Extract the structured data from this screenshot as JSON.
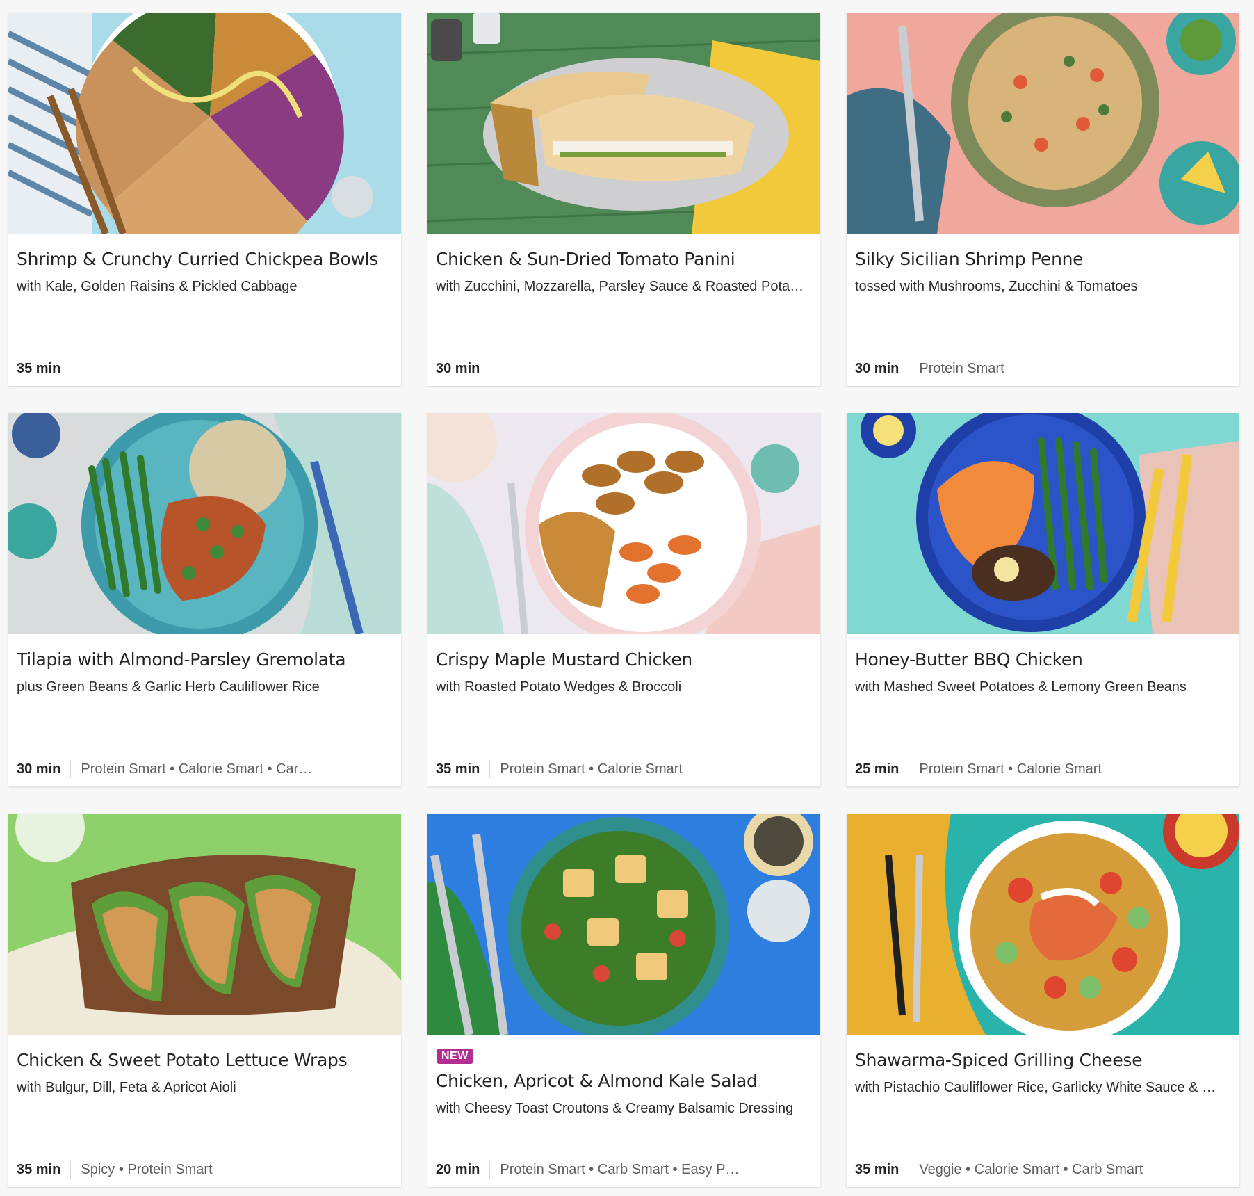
{
  "recipes": [
    {
      "title": "Shrimp & Crunchy Curried Chickpea Bowls",
      "subtitle": "with Kale, Golden Raisins & Pickled Cabbage",
      "time": "35 min",
      "tags": "",
      "badge": "",
      "image": "bowl-with-chickpeas-kale-cabbage",
      "bg_color": "#a9dbe8",
      "accent": "#d9b34a"
    },
    {
      "title": "Chicken & Sun-Dried Tomato Panini",
      "subtitle": "with Zucchini, Mozzarella, Parsley Sauce & Roasted Pota…",
      "time": "30 min",
      "tags": "",
      "badge": "",
      "image": "panini-on-plate",
      "bg_color": "#4f8a57",
      "accent": "#e9c98f"
    },
    {
      "title": "Silky Sicilian Shrimp Penne",
      "subtitle": "tossed with Mushrooms, Zucchini & Tomatoes",
      "time": "30 min",
      "tags": "Protein Smart",
      "badge": "",
      "image": "penne-bowl",
      "bg_color": "#f0a79c",
      "accent": "#d9b47c"
    },
    {
      "title": "Tilapia with Almond-Parsley Gremolata",
      "subtitle": "plus Green Beans & Garlic Herb Cauliflower Rice",
      "time": "30 min",
      "tags": "Protein Smart • Calorie Smart • Car…",
      "badge": "",
      "image": "tilapia-plate",
      "bg_color": "#d9dcdc",
      "accent": "#c0652c"
    },
    {
      "title": "Crispy Maple Mustard Chicken",
      "subtitle": "with Roasted Potato Wedges & Broccoli",
      "time": "35 min",
      "tags": "Protein Smart • Calorie Smart",
      "badge": "",
      "image": "chicken-potato-plate",
      "bg_color": "#f3c9c3",
      "accent": "#e2722e"
    },
    {
      "title": "Honey-Butter BBQ Chicken",
      "subtitle": "with Mashed Sweet Potatoes & Lemony Green Beans",
      "time": "25 min",
      "tags": "Protein Smart • Calorie Smart",
      "badge": "",
      "image": "bbq-chicken-plate",
      "bg_color": "#7fd8d2",
      "accent": "#f28a3c"
    },
    {
      "title": "Chicken & Sweet Potato Lettuce Wraps",
      "subtitle": "with Bulgur, Dill, Feta & Apricot Aioli",
      "time": "35 min",
      "tags": "Spicy • Protein Smart",
      "badge": "",
      "image": "lettuce-wraps-board",
      "bg_color": "#8ed06a",
      "accent": "#7a4a2a"
    },
    {
      "title": "Chicken, Apricot & Almond Kale Salad",
      "subtitle": "with Cheesy Toast Croutons & Creamy Balsamic Dressing",
      "time": "20 min",
      "tags": "Protein Smart • Carb Smart • Easy P…",
      "badge": "NEW",
      "image": "kale-salad-bowl",
      "bg_color": "#2e7ee0",
      "accent": "#efc26a"
    },
    {
      "title": "Shawarma-Spiced Grilling Cheese",
      "subtitle": "with Pistachio Cauliflower Rice, Garlicky White Sauce & …",
      "time": "35 min",
      "tags": "Veggie • Calorie Smart • Carb Smart",
      "badge": "",
      "image": "shawarma-rice-bowl",
      "bg_color": "#29b3aa",
      "accent": "#e8b02e"
    }
  ]
}
